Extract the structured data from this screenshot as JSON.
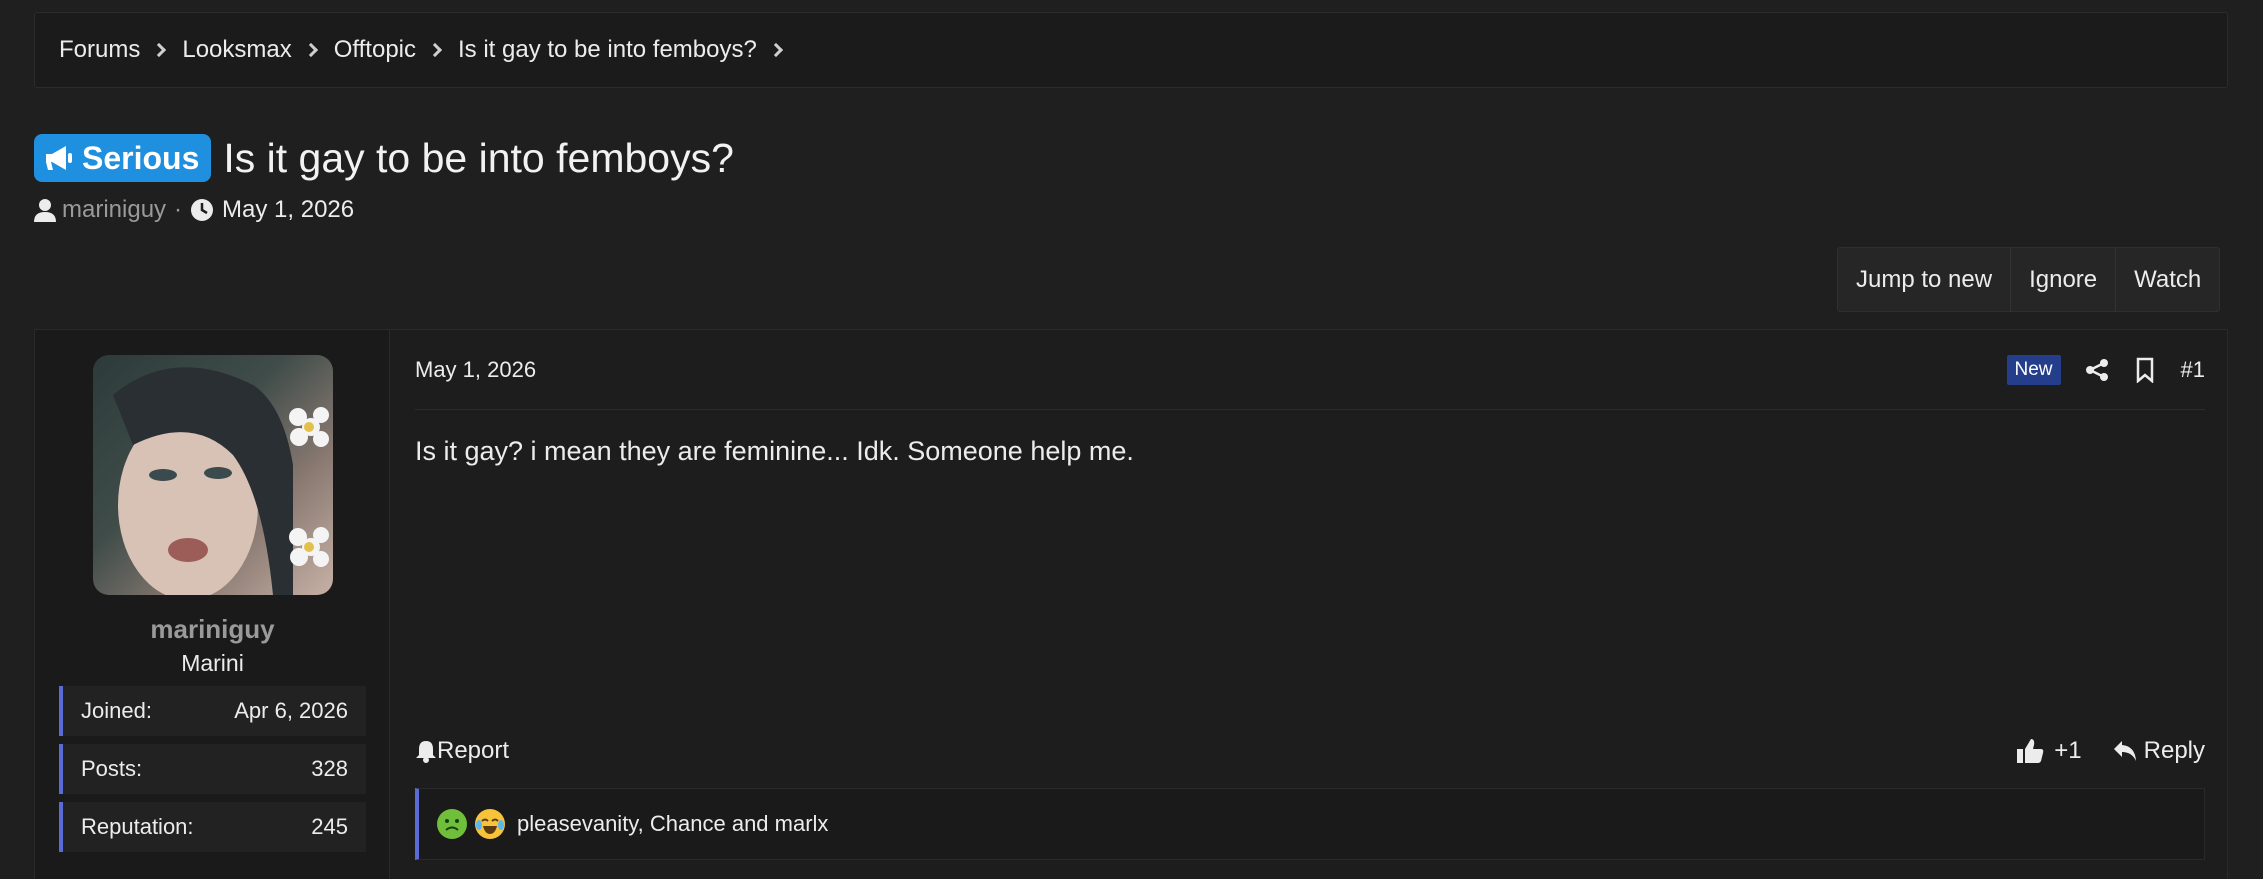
{
  "breadcrumb": [
    "Forums",
    "Looksmax",
    "Offtopic",
    "Is it gay to be into femboys?"
  ],
  "thread": {
    "prefix": "Serious",
    "title": "Is it gay to be into femboys?",
    "author": "mariniguy",
    "date": "May 1, 2026",
    "meta_separator": "·"
  },
  "actions": [
    "Jump to new",
    "Ignore",
    "Watch"
  ],
  "post": {
    "user": {
      "name": "mariniguy",
      "title": "Marini",
      "stats": [
        {
          "label": "Joined:",
          "value": "Apr 6, 2026"
        },
        {
          "label": "Posts:",
          "value": "328"
        },
        {
          "label": "Reputation:",
          "value": "245"
        }
      ]
    },
    "date": "May 1, 2026",
    "badge": "New",
    "number": "#1",
    "body": "Is it gay? i mean they are feminine... Idk. Someone help me.",
    "report_label": "Report",
    "like_label": "+1",
    "reply_label": "Reply",
    "reactions_text": "pleasevanity, Chance and marlx"
  },
  "colors": {
    "accent": "#5b6bd6",
    "prefix": "#1f8fe0",
    "badge": "#253e8c"
  },
  "icons": [
    "chevron-right-icon",
    "megaphone-icon",
    "user-icon",
    "clock-icon",
    "share-icon",
    "bookmark-icon",
    "bell-icon",
    "thumbs-up-icon",
    "reply-icon",
    "nauseated-emoji-icon",
    "crying-laughing-emoji-icon"
  ]
}
